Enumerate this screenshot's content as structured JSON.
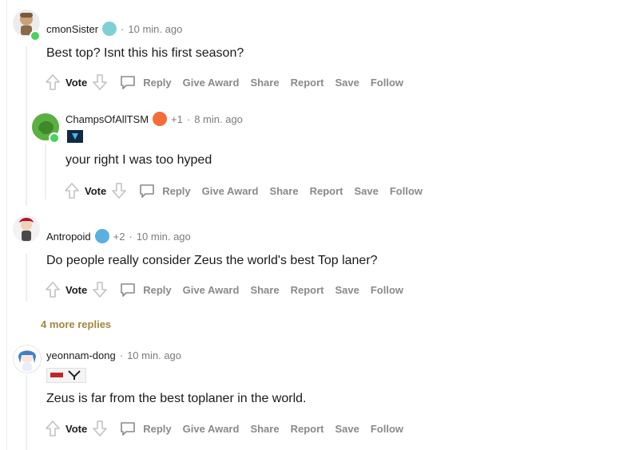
{
  "comments": [
    {
      "username": "cmonSister",
      "awards_count": "",
      "time": "10 min. ago",
      "body": "Best top? Isnt this his first season?",
      "actions": {
        "vote": "Vote",
        "reply": "Reply",
        "award": "Give Award",
        "share": "Share",
        "report": "Report",
        "save": "Save",
        "follow": "Follow"
      }
    },
    {
      "username": "ChampsOfAllTSM",
      "awards_count": "+1",
      "time": "8 min. ago",
      "body": "your right I was too hyped",
      "actions": {
        "vote": "Vote",
        "reply": "Reply",
        "award": "Give Award",
        "share": "Share",
        "report": "Report",
        "save": "Save",
        "follow": "Follow"
      }
    },
    {
      "username": "Antropoid",
      "awards_count": "+2",
      "time": "10 min. ago",
      "body": "Do people really consider Zeus the world's best Top laner?",
      "actions": {
        "vote": "Vote",
        "reply": "Reply",
        "award": "Give Award",
        "share": "Share",
        "report": "Report",
        "save": "Save",
        "follow": "Follow"
      }
    },
    {
      "username": "yeonnam-dong",
      "awards_count": "",
      "time": "10 min. ago",
      "body": "Zeus is far from the best toplaner in the world.",
      "actions": {
        "vote": "Vote",
        "reply": "Reply",
        "award": "Give Award",
        "share": "Share",
        "report": "Report",
        "save": "Save",
        "follow": "Follow"
      }
    }
  ],
  "more_replies": "4 more replies",
  "separator": "·",
  "colors": {
    "online": "#46d160",
    "more_replies": "#a5863c",
    "meta": "#7c7c7c",
    "action": "#878a8c"
  }
}
